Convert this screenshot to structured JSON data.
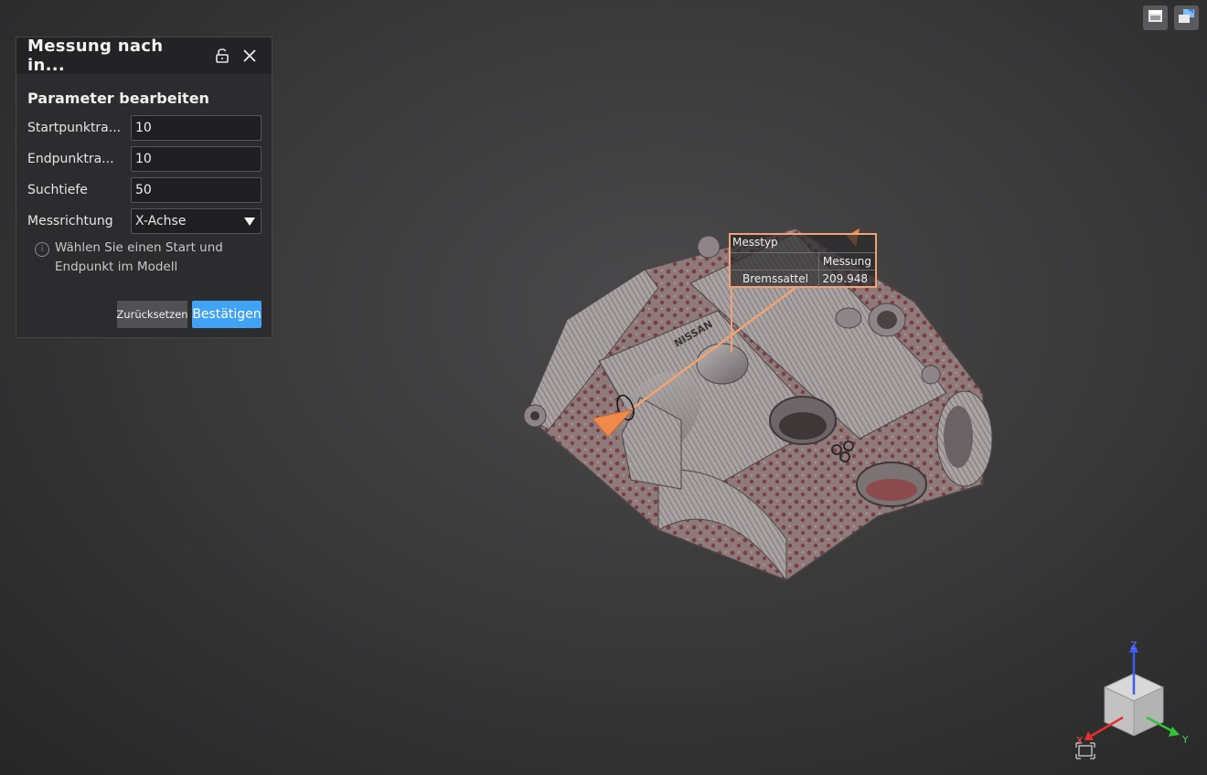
{
  "toolbar": {
    "icons": [
      "view-panel-icon",
      "view-switch-icon"
    ]
  },
  "panel": {
    "title": "Messung nach in...",
    "section_title": "Parameter bearbeiten",
    "fields": [
      {
        "label": "Startpunktra...",
        "value": "10"
      },
      {
        "label": "Endpunktra...",
        "value": "10"
      },
      {
        "label": "Suchtiefe",
        "value": "50"
      }
    ],
    "direction": {
      "label": "Messrichtung",
      "value": "X-Achse"
    },
    "hint": "Wählen Sie einen Start und Endpunkt im Modell",
    "reset_label": "Zurücksetzen",
    "confirm_label": "Bestätigen"
  },
  "measurement": {
    "type_label": "Messtyp",
    "column_header": "Messung",
    "row_name": "Bremssattel",
    "row_value": "209.948"
  },
  "gizmo": {
    "axis_x": "X",
    "axis_y": "Y",
    "axis_z": "Z"
  },
  "colors": {
    "accent": "#41a3f5",
    "measure_line": "#f2a272",
    "cone": "#f08a4a",
    "axis_x": "#e53030",
    "axis_y": "#2fc23a",
    "axis_z": "#3a5cf0"
  }
}
